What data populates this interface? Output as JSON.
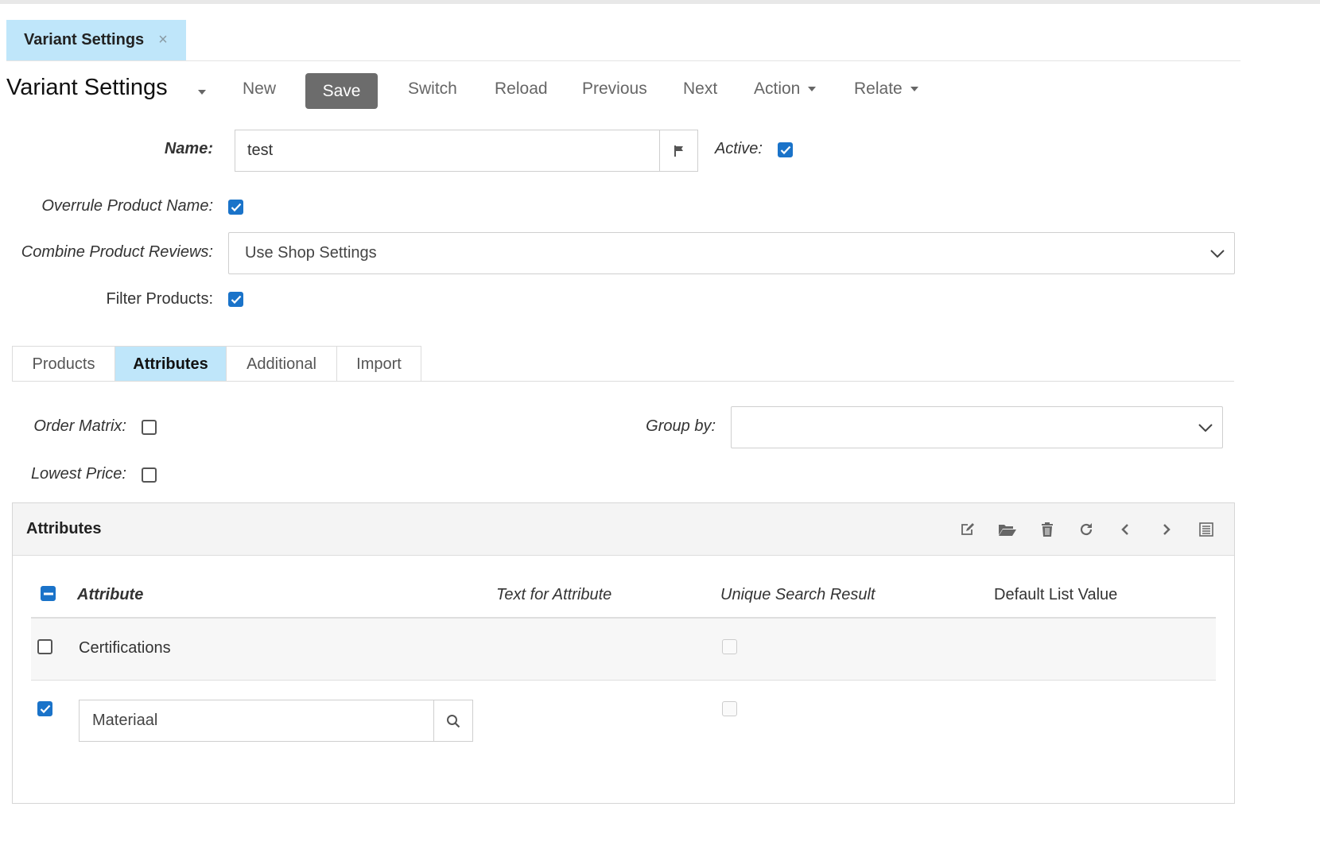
{
  "doc_tab": {
    "label": "Variant Settings",
    "close": "×"
  },
  "page_title": "Variant Settings",
  "toolbar": {
    "new": "New",
    "save": "Save",
    "switch": "Switch",
    "reload": "Reload",
    "previous": "Previous",
    "next": "Next",
    "action": "Action",
    "relate": "Relate"
  },
  "form": {
    "name_label": "Name:",
    "name_value": "test",
    "active_label": "Active:",
    "active_checked": true,
    "overrule_label": "Overrule Product Name:",
    "overrule_checked": true,
    "combine_label": "Combine Product Reviews:",
    "combine_value": "Use Shop Settings",
    "filter_label": "Filter Products:",
    "filter_checked": true
  },
  "subtabs": [
    {
      "label": "Products",
      "active": false
    },
    {
      "label": "Attributes",
      "active": true
    },
    {
      "label": "Additional",
      "active": false
    },
    {
      "label": "Import",
      "active": false
    }
  ],
  "attributes_tab": {
    "order_matrix_label": "Order Matrix:",
    "order_matrix_checked": false,
    "lowest_price_label": "Lowest Price:",
    "lowest_price_checked": false,
    "group_by_label": "Group by:",
    "group_by_value": ""
  },
  "panel": {
    "title": "Attributes",
    "icons": [
      "edit-icon",
      "folder-open-icon",
      "trash-icon",
      "refresh-icon",
      "chevron-left-icon",
      "chevron-right-icon",
      "list-view-icon"
    ],
    "columns": [
      "Attribute",
      "Text for Attribute",
      "Unique Search Result",
      "Default List Value"
    ],
    "rows": [
      {
        "selected": false,
        "attribute": "Certifications",
        "unique_search": false
      },
      {
        "selected": true,
        "attribute": "Materiaal",
        "unique_search": false,
        "editing": true
      }
    ]
  },
  "colors": {
    "accent_blue": "#1a73c9",
    "tab_highlight": "#bfe6fa",
    "save_bg": "#6c6c6c"
  }
}
